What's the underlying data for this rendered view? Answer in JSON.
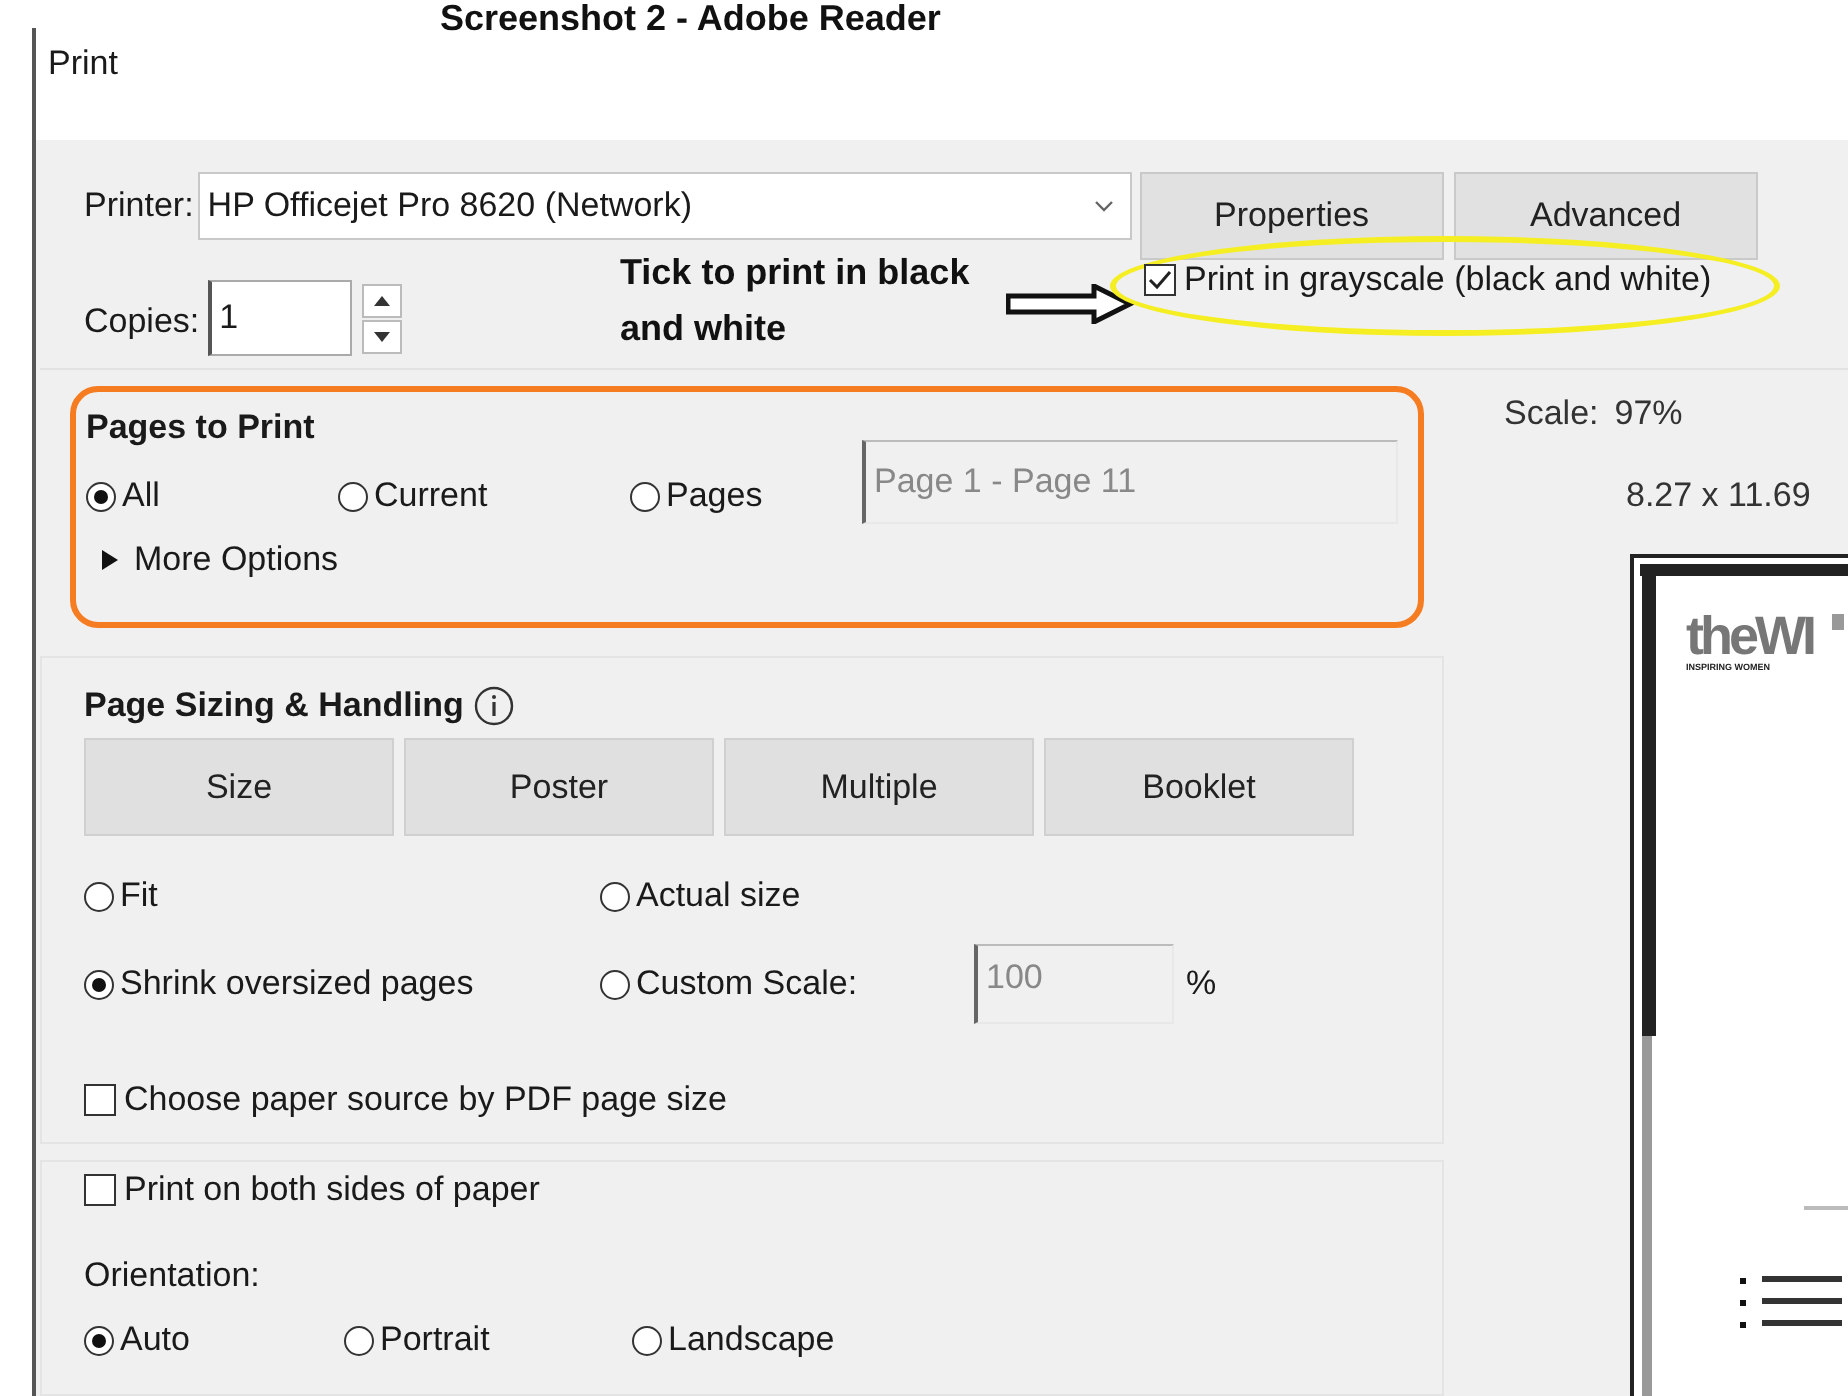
{
  "caption": "Screenshot 2 - Adobe Reader",
  "window": {
    "title": "Print"
  },
  "printer": {
    "label": "Printer:",
    "value": "HP Officejet Pro 8620 (Network)"
  },
  "buttons": [
    "Properties",
    "Advanced"
  ],
  "copies": {
    "label": "Copies:",
    "value": "1"
  },
  "annotation": {
    "text": "Tick to print in black and white"
  },
  "grayscale": {
    "label": "Print in grayscale (black and white)",
    "checked": true
  },
  "pages_to_print": {
    "title": "Pages to Print",
    "options": [
      {
        "label": "All",
        "selected": true
      },
      {
        "label": "Current",
        "selected": false
      },
      {
        "label": "Pages",
        "selected": false
      }
    ],
    "range": {
      "value": "Page 1 - Page 11",
      "disabled": true
    },
    "more_options": {
      "label": "More Options",
      "expanded": false
    }
  },
  "sizing": {
    "title": "Page Sizing & Handling",
    "buttons": [
      "Size",
      "Poster",
      "Multiple",
      "Booklet"
    ],
    "options": [
      {
        "label": "Fit",
        "selected": false
      },
      {
        "label": "Actual size",
        "selected": false
      },
      {
        "label": "Shrink oversized pages",
        "selected": true
      },
      {
        "label": "Custom Scale:",
        "selected": false
      }
    ],
    "scale": {
      "value": "100",
      "disabled": true,
      "unit": "%"
    },
    "paper_source": {
      "label": "Choose paper source by PDF page size",
      "checked": false
    }
  },
  "duplex": {
    "label": "Print on both sides of paper",
    "checked": false
  },
  "orientation": {
    "label": "Orientation:",
    "options": [
      {
        "label": "Auto",
        "selected": true
      },
      {
        "label": "Portrait",
        "selected": false
      },
      {
        "label": "Landscape",
        "selected": false
      }
    ]
  },
  "preview": {
    "scale_label": "Scale:",
    "scale": "97%",
    "size": "8.27 x 11.69",
    "logo": "theWI",
    "tagline": "INSPIRING WOMEN"
  }
}
